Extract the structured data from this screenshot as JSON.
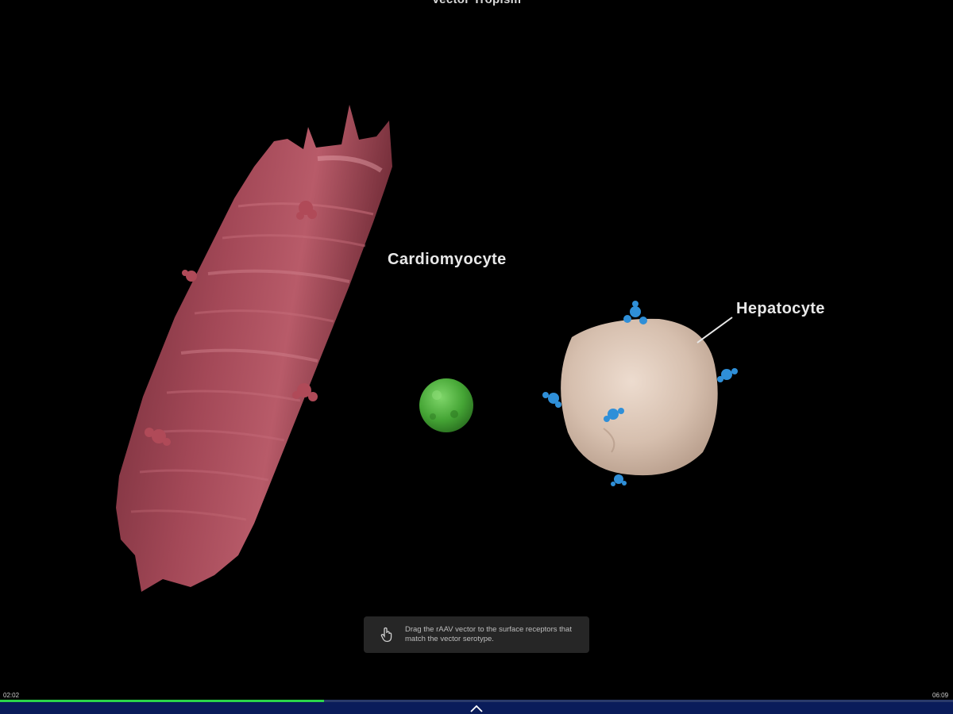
{
  "scene": {
    "title": "Vector Tropism"
  },
  "cells": {
    "cardiomyocyte_label": "Cardiomyocyte",
    "hepatocyte_label": "Hepatocyte"
  },
  "hint": {
    "icon": "pointer-hand-icon",
    "text": "Drag the rAAV vector to the surface receptors that match the vector serotype."
  },
  "player": {
    "elapsed": "02:02",
    "duration": "06:09",
    "progress": 0.34,
    "expand_icon": "chevron-up-icon"
  },
  "colors": {
    "cardiomyocyte": "#9a3e4c",
    "hepatocyte": "#d9c3b4",
    "vector": "#4caf3c",
    "receptor_blue": "#2f8fd8",
    "progress_fill": "#2bd64a",
    "bottom_bar": "#0a1c5a"
  }
}
